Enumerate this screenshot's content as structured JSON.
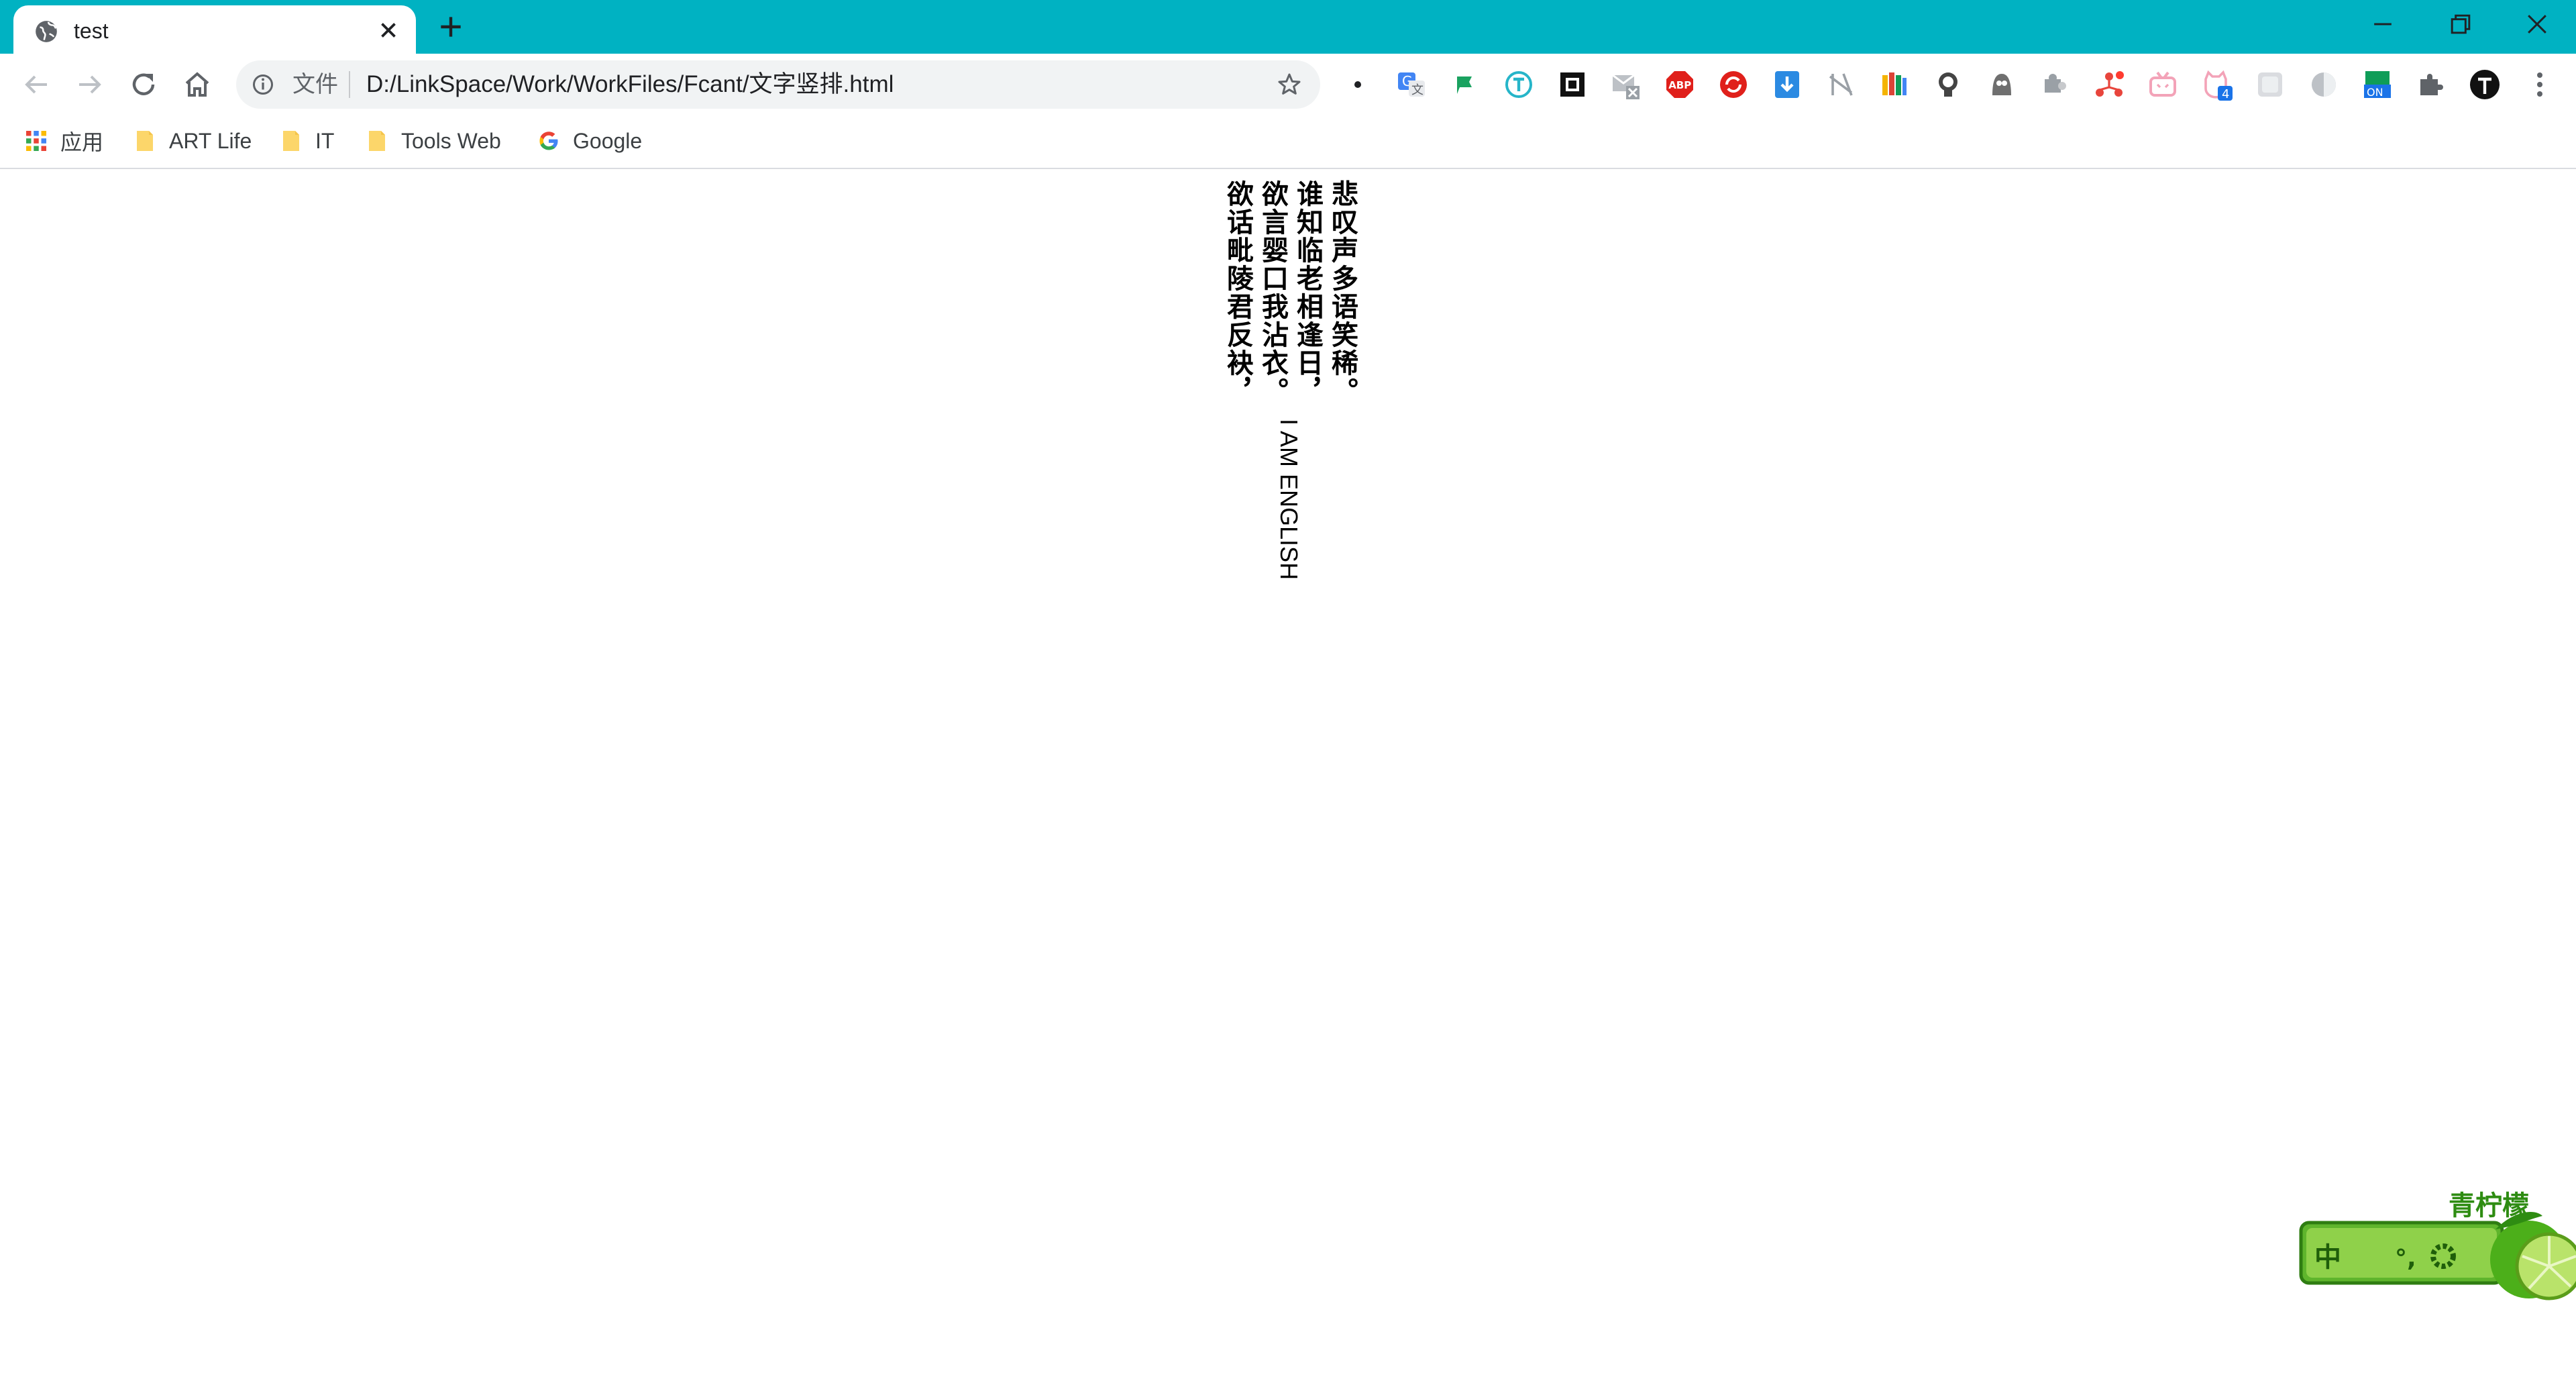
{
  "tab": {
    "title": "test"
  },
  "omnibox": {
    "scheme_label": "文件",
    "url": "D:/LinkSpace/Work/WorkFiles/Fcant/文字竖排.html"
  },
  "extensions": {
    "badge_count": "4",
    "abp_label": "ABP",
    "on_label": "ON"
  },
  "bookmarks": [
    {
      "label": "应用",
      "icon": "apps-grid-icon"
    },
    {
      "label": "ART Life",
      "icon": "folder-icon"
    },
    {
      "label": "IT",
      "icon": "folder-icon"
    },
    {
      "label": "Tools Web",
      "icon": "folder-icon"
    },
    {
      "label": "Google",
      "icon": "google-icon"
    }
  ],
  "page": {
    "poem_lines": [
      "悲叹声多语笑稀。",
      "谁知临老相逢日，",
      "欲言婴口我沾衣。",
      "欲话毗陵君反袂，"
    ],
    "english_text": "I AM ENGLISH"
  },
  "ime": {
    "brand": "青柠檬",
    "mode": "中",
    "punct": "°,",
    "lang_icon": "moon-icon",
    "settings_icon": "gear-icon"
  },
  "colors": {
    "tabbar": "#00b2c2",
    "omnibox": "#f1f3f4",
    "ime_green": "#3d9a1f"
  }
}
